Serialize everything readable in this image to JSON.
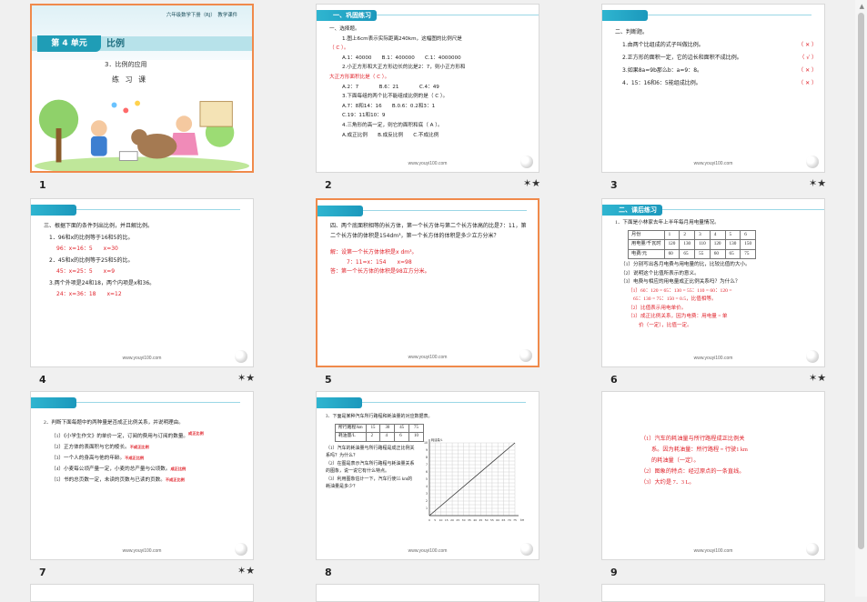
{
  "footer_url": "www.youyi100.com",
  "accent_color": "#e0222a",
  "selected_color": "#f08a4b",
  "slides": {
    "s1": {
      "number": "1",
      "header": "六年级数学下册（RJ）　教学课件",
      "unit": "第 4 单元",
      "chapter": "比例",
      "subtitle": "3．比例的应用",
      "lesson": "练 习 课"
    },
    "s2": {
      "number": "2",
      "tag": "一、巩固练习",
      "lines": [
        "一、选择题。",
        "1.图上6cm表示实际距离240km，这幅图的比例尺是",
        "（ C ）。",
        "A.1：40000　　B.1：400000　　C.1：4000000",
        "2.小正方形和大正方形边长的比是2：7，则小正方形和",
        "大正方形面积比是（ C ）。",
        "A.2：7　　　　B.6：21　　　　C.4：49",
        "3.下面每组的两个比不能组成比例的是（ C ）。",
        "A.7：8和14：16　　B.0.6：0.2和3：1",
        "C.19：11和10：9",
        "4.三角形的高一定，则它的面积和底（ A ）。",
        "A.成正比例　　B.成反比例　　C.不成比例"
      ]
    },
    "s3": {
      "number": "3",
      "title": "二、判断题。",
      "items": [
        {
          "text": "1.由两个比组成的式子叫做比例。",
          "mark": "（ ✕ ）"
        },
        {
          "text": "2.正方形的面积一定，它的边长和面积不成比例。",
          "mark": "（ √ ）"
        },
        {
          "text": "3.如果8a=9b那么b：a=9：8。",
          "mark": "（ ✕ ）"
        },
        {
          "text": "4．15：16和6：5能组成比例。",
          "mark": "（ ✕ ）"
        }
      ]
    },
    "s4": {
      "number": "4",
      "lines": [
        "三、根据下面的条件列出比例，并且解比例。",
        "1．96和x的比例等于16和5的比。",
        "96：x=16：5　　x=30",
        "2．45和x的比例等于25和5的比。",
        "45：x=25：5　　x=9",
        "3.两个外项是24和18，两个内项是x和36。",
        "24：x=36：18　　x=12"
      ]
    },
    "s5": {
      "number": "5",
      "question": "四、两个底面积相等的长方体，第一个长方体与第二个长方体高的比是7：11，第二个长方体的体积是154dm³，第一个长方体的体积是多少立方分米？",
      "solution": "解：设第一个长方体体积是x dm³。",
      "eq1": "7：11=x：154　　x=98",
      "answer": "答：第一个长方体的体积是98立方分米。"
    },
    "s6": {
      "number": "6",
      "tag": "二、课后练习",
      "intro": "1．下面是小林家去年上半年每月用电量情况。",
      "table": {
        "headers": [
          "月份",
          "1",
          "2",
          "3",
          "4",
          "5",
          "6"
        ],
        "row1": [
          "用电量/千瓦时",
          "120",
          "130",
          "110",
          "120",
          "130",
          "150"
        ],
        "row2": [
          "电费/元",
          "60",
          "65",
          "55",
          "60",
          "65",
          "75"
        ]
      },
      "q1": "（1）分别写出各月电费与用电量的比，比较比值的大小。",
      "q2": "（2）说明这个比值所表示的意义。",
      "q3": "（3）电费与相应的用电量成正比例关系吗？为什么？",
      "a1": "（1）60：120 = 65：130 = 55：110 = 60：120 =",
      "a1b": "65：130 = 75：150 = 0.5，比值相等。",
      "a2": "（2）比值表示用电单价。",
      "a3": "（3）成正比例关系，因为电费：用电量 = 单",
      "a3b": "价（一定），比值一定。"
    },
    "s7": {
      "number": "7",
      "q": "2．判断下面每题中的两种量是否成正比例关系，并说明理由。",
      "items": [
        {
          "text": "（1）《小学生作文》的单价一定，订阅的费用与订阅的数量。",
          "mark": "成正比例"
        },
        {
          "text": "（2）正方体的表面积与它的棱长。",
          "mark": "不成正比例"
        },
        {
          "text": "（3）一个人的身高与他的年龄。",
          "mark": "不成正比例"
        },
        {
          "text": "（4）小麦每公顷产量一定，小麦的总产量与公顷数。",
          "mark": "成正比例"
        },
        {
          "text": "（5）书的总页数一定，未读的页数与已读的页数。",
          "mark": "不成正比例"
        }
      ]
    },
    "s8": {
      "number": "8",
      "intro": "3．下面是某种汽车所行路程和耗油量的对应数据表。",
      "table": {
        "row1": [
          "所行路程/km",
          "15",
          "30",
          "45",
          "75"
        ],
        "row2": [
          "耗油量/L",
          "2",
          "4",
          "6",
          "10"
        ]
      },
      "q1": "（1）汽车的耗油量与所行路程是成正比例关系吗？为什么？",
      "q2": "（2）在图是表示汽车所行路程与耗油量关系的图象，说一说它有什么特点。",
      "q3": "（3）利用图象估计一下，汽车行使55 km的耗油量是多少？"
    },
    "s9": {
      "number": "9",
      "a1": "（1）汽车的耗油量与所行路程成正比例关",
      "a1b": "系。因为耗油量：所行路程 = 行驶1 km",
      "a1c": "的耗油量（一定）。",
      "a2": "（2）图象的特点：经过原点的一条直线。",
      "a3": "（3）大约是 7．3 L。"
    }
  },
  "chart_data": {
    "type": "line",
    "title": "",
    "xlabel": "km",
    "ylabel": "耗油量/L",
    "x_ticks": [
      "0",
      "5",
      "10",
      "15",
      "20",
      "25",
      "30",
      "35",
      "40",
      "45",
      "50",
      "55",
      "60",
      "65",
      "70",
      "75"
    ],
    "y_ticks": [
      "1",
      "2",
      "3",
      "4",
      "5",
      "6",
      "7",
      "8",
      "9",
      "10"
    ],
    "xlim": [
      0,
      75
    ],
    "ylim": [
      0,
      10
    ],
    "x": [
      0,
      75
    ],
    "y": [
      0,
      10
    ],
    "grid": true
  }
}
